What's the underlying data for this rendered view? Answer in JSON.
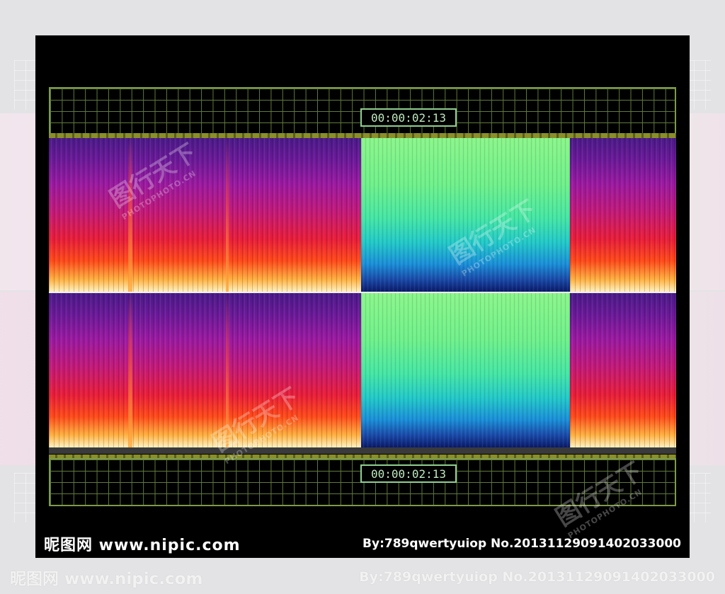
{
  "display": {
    "timecode_top": "00:00:02:13",
    "timecode_bottom": "00:00:02:13"
  },
  "footer": {
    "brand": "昵图网 www.nipic.com",
    "credit": "By:789qwertyuiop  No.20131129091402033000"
  },
  "watermark": {
    "mark": "图行天下",
    "site": "PHOTOPHOTO.CN"
  },
  "colors": {
    "frame": "#000000",
    "grid": "#7e9a48",
    "timecode_border": "#8fd08f",
    "warm_spectrum_top": "#4a1a88",
    "warm_spectrum_bottom": "#fff2c0",
    "cool_spectrum_top": "#8af58a",
    "cool_spectrum_bottom": "#0a1a6a"
  }
}
